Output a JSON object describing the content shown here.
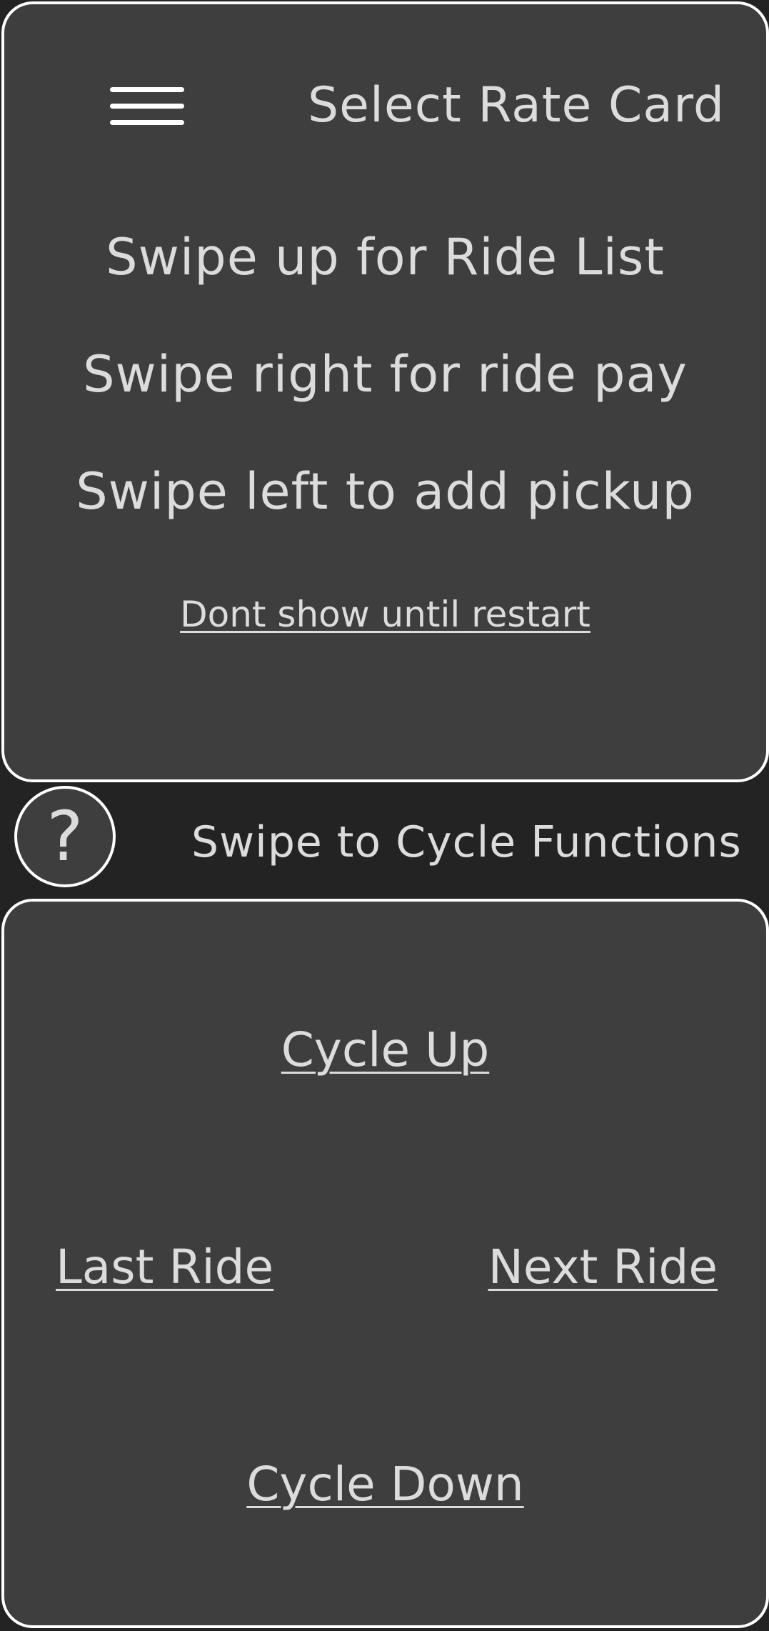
{
  "header": {
    "menu_icon": "hamburger-menu-icon",
    "title": "Select Rate Card"
  },
  "hints": [
    "Swipe up for Ride List",
    "Swipe right for ride pay",
    "Swipe left to add pickup"
  ],
  "dont_show_label": "Dont show until restart",
  "help": {
    "icon": "question-icon",
    "symbol": "?"
  },
  "cycle_label": "Swipe to Cycle Functions",
  "controls": {
    "cycle_up": "Cycle Up",
    "last_ride": "Last Ride",
    "next_ride": "Next Ride",
    "cycle_down": "Cycle Down"
  },
  "colors": {
    "background": "#232323",
    "panel": "#3e3e3e",
    "border": "#ffffff",
    "text": "#dcdcdc"
  }
}
